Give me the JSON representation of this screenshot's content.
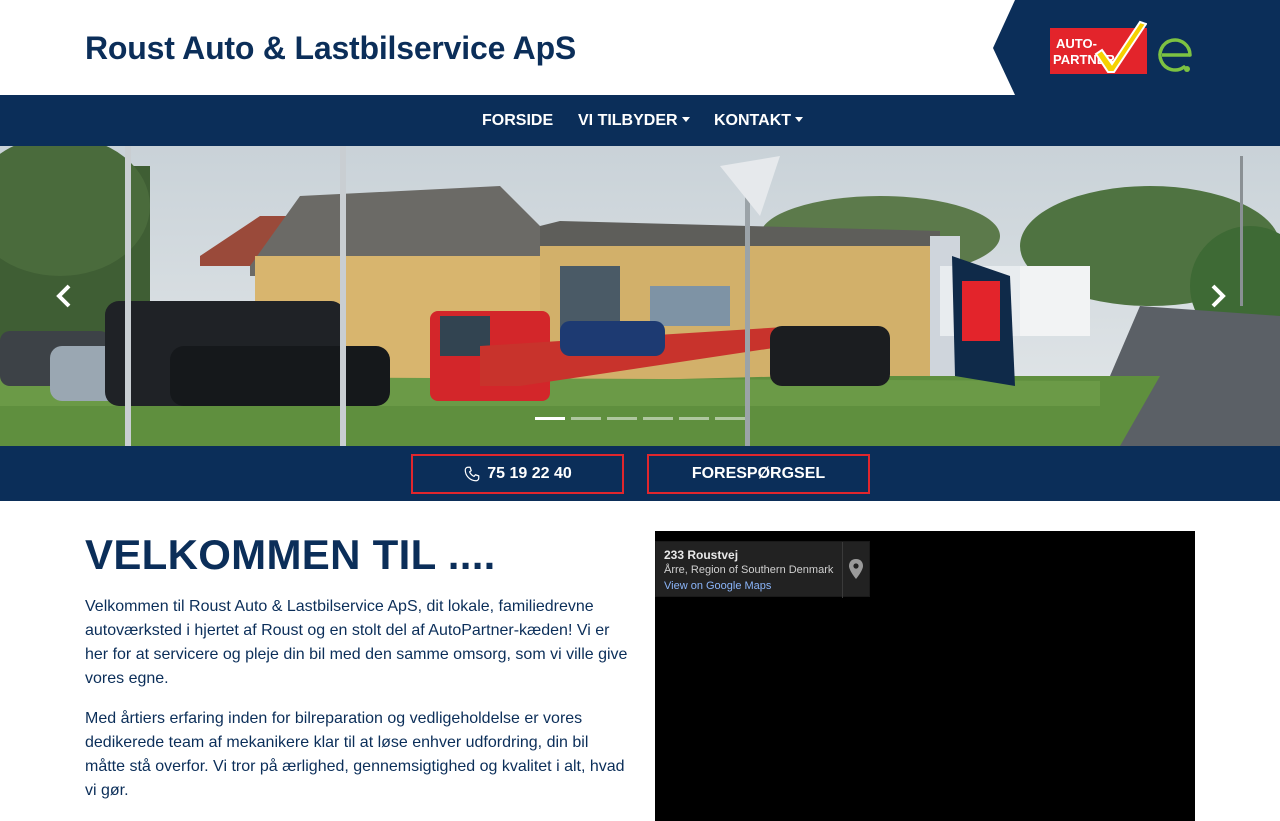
{
  "site": {
    "title": "Roust Auto & Lastbilservice ApS",
    "logo_text_line1": "AUTO-",
    "logo_text_line2": "PARTNER"
  },
  "colors": {
    "brand_navy": "#0b2e59",
    "cta_border": "#e0262d",
    "autopartner_red": "#e3242b",
    "autopartner_yellow": "#f6d100",
    "e_green": "#7dc242"
  },
  "nav": {
    "items": [
      {
        "label": "FORSIDE",
        "dropdown": false
      },
      {
        "label": "VI TILBYDER",
        "dropdown": true
      },
      {
        "label": "KONTAKT",
        "dropdown": true
      }
    ]
  },
  "hero": {
    "indicator_count": 6,
    "active_index": 0,
    "icons": {
      "prev": "chevron-left-icon",
      "next": "chevron-right-icon"
    }
  },
  "cta": {
    "phone": "75 19 22 40",
    "phone_icon": "phone-icon",
    "inquiry": "FORESPØRGSEL"
  },
  "welcome": {
    "title": "VELKOMMEN TIL ....",
    "paragraphs": [
      "Velkommen til Roust Auto & Lastbilservice ApS, dit lokale, familiedrevne autoværksted i hjertet af Roust og en stolt del af AutoPartner-kæden! Vi er her for at servicere og pleje din bil med den samme omsorg, som vi ville give vores egne.",
      "Med årtiers erfaring inden for bilreparation og vedligeholdelse er vores dedikerede team af mekanikere klar til at løse enhver udfordring, din bil måtte stå overfor. Vi tror på ærlighed, gennemsigtighed og kvalitet i alt, hvad vi gør."
    ]
  },
  "map": {
    "address": "233 Roustvej",
    "region": "Årre, Region of Southern Denmark",
    "link": "View on Google Maps",
    "pin_icon": "map-pin-icon"
  }
}
